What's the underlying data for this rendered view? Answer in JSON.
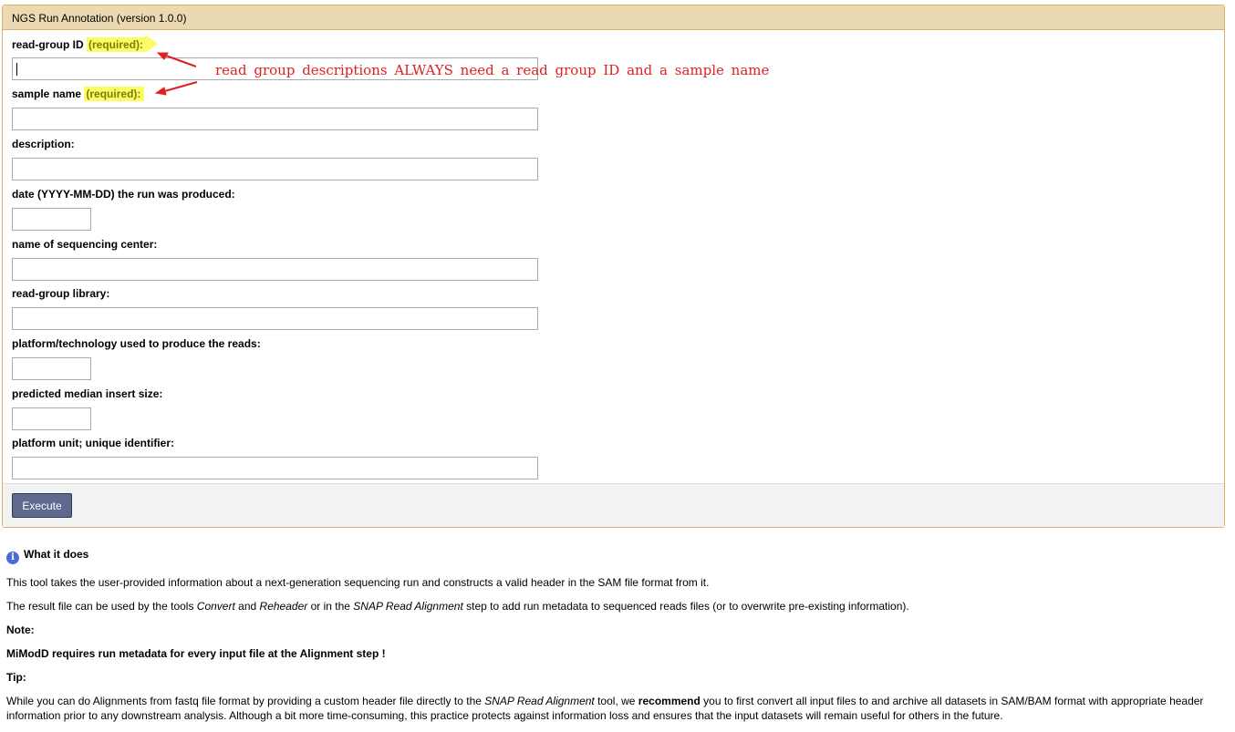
{
  "tool": {
    "title": "NGS Run Annotation (version 1.0.0)"
  },
  "fields": [
    {
      "label": "read-group ID",
      "required": "(required):"
    },
    {
      "label": "sample name",
      "required": "(required):"
    },
    {
      "label": "description:"
    },
    {
      "label": "date (YYYY-MM-DD) the run was produced:"
    },
    {
      "label": "name of sequencing center:"
    },
    {
      "label": "read-group library:"
    },
    {
      "label": "platform/technology used to produce the reads:"
    },
    {
      "label": "predicted median insert size:"
    },
    {
      "label": "platform unit; unique identifier:"
    }
  ],
  "execute_label": "Execute",
  "annotation_text": "read group descriptions ALWAYS need a read group ID and a sample name",
  "help": {
    "title": "What it does",
    "info_icon": "info-icon",
    "p1": "This tool takes the user-provided information about a next-generation sequencing run and constructs a valid header in the SAM file format from it.",
    "p2_a": "The result file can be used by the tools ",
    "p2_convert": "Convert",
    "p2_b": " and ",
    "p2_reheader": "Reheader",
    "p2_c": " or in the ",
    "p2_snap": "SNAP Read Alignment",
    "p2_d": " step to add run metadata to sequenced reads files (or to overwrite pre-existing information).",
    "note_label": "Note:",
    "note_text": "MiModD requires run metadata for every input file at the Alignment step !",
    "tip_label": "Tip:",
    "tip_a": "While you can do Alignments from fastq file format by providing a custom header file directly to the ",
    "tip_snap": "SNAP Read Alignment",
    "tip_b": " tool, we ",
    "tip_recommend": "recommend",
    "tip_c": " you to first convert all input files to and archive all datasets in SAM/BAM format with appropriate header information prior to any downstream analysis. Although a bit more time-consuming, this practice protects against information loss and ensures that the input datasets will remain useful for others in the future."
  },
  "colors": {
    "header_bg": "#ebd9b2",
    "border": "#d8b365",
    "required_highlight": "#fcfc66",
    "execute_button": "#5f6990",
    "annotation": "#e02020"
  }
}
